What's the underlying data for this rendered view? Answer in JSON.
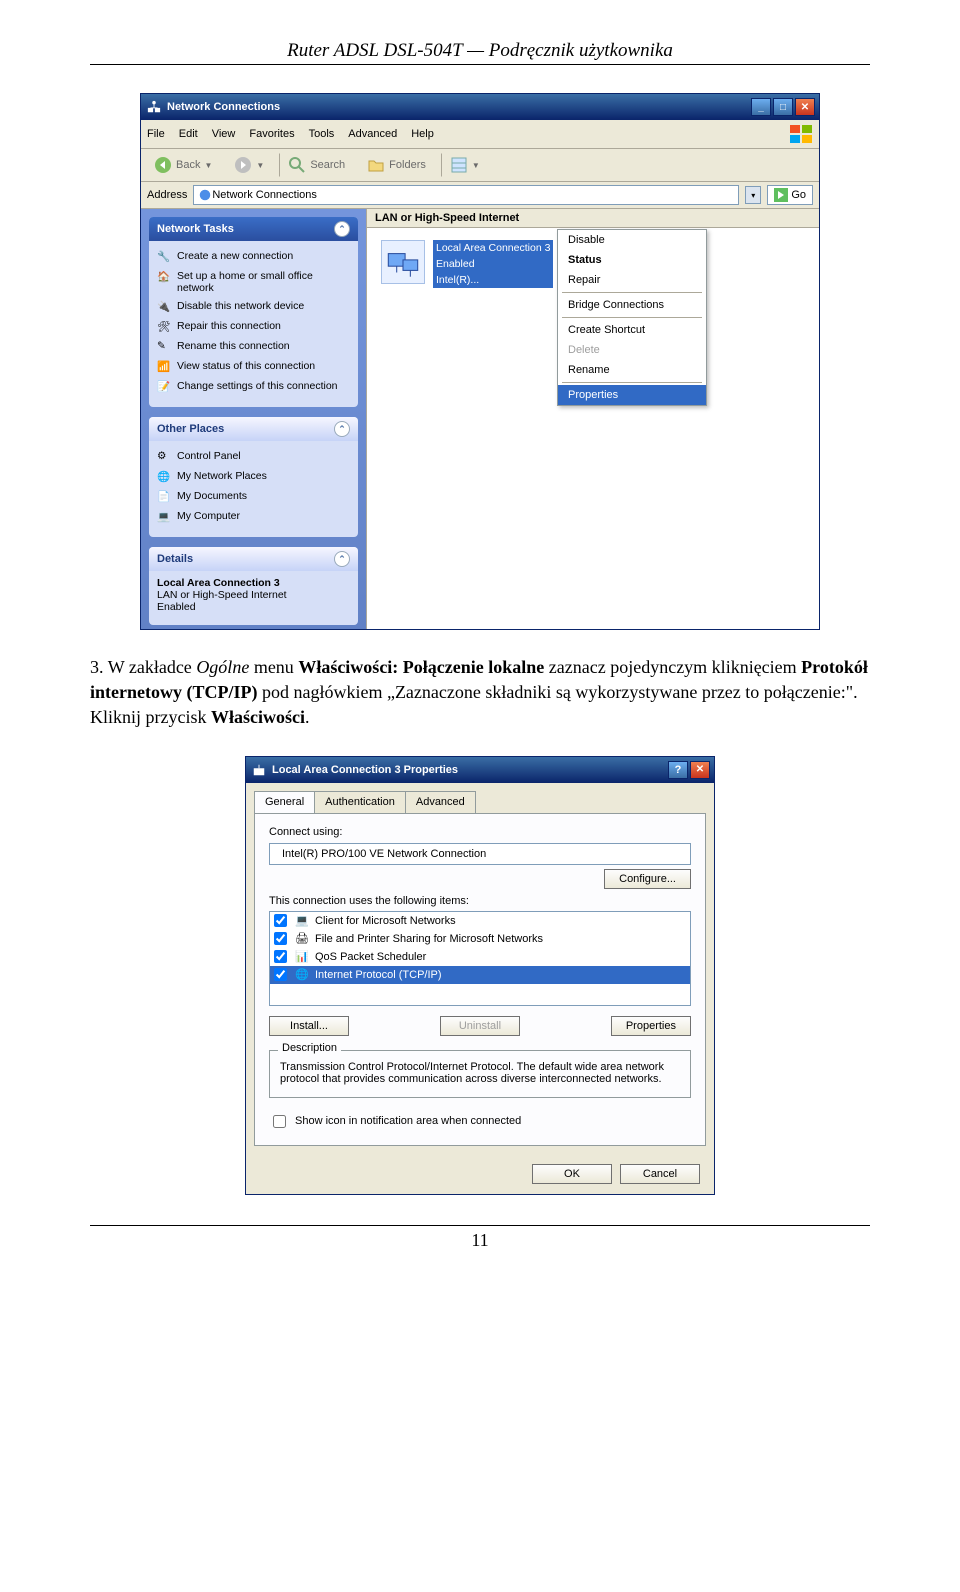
{
  "doc": {
    "header": "Ruter ADSL DSL-504T — Podręcznik użytkownika",
    "page_number": "11"
  },
  "instruction": {
    "num": "3.",
    "part1": "W zakładce ",
    "ogolne": "Ogólne",
    "part2": " menu ",
    "wlasc": "Właściwości: Połączenie lokalne",
    "part3": " zaznacz pojedynczym kliknięciem ",
    "proto": "Protokół internetowy (TCP/IP)",
    "part4": " pod nagłówkiem „Zaznaczone składniki są wykorzystywane przez to połączenie:\". Kliknij przycisk ",
    "btn": "Właściwości",
    "dot": "."
  },
  "win1": {
    "title": "Network Connections",
    "menus": [
      "File",
      "Edit",
      "View",
      "Favorites",
      "Tools",
      "Advanced",
      "Help"
    ],
    "toolbar": {
      "back": "Back",
      "search": "Search",
      "folders": "Folders"
    },
    "addr": {
      "label": "Address",
      "value": "Network Connections",
      "go": "Go"
    },
    "panels": {
      "tasks_title": "Network Tasks",
      "tasks": [
        "Create a new connection",
        "Set up a home or small office network",
        "Disable this network device",
        "Repair this connection",
        "Rename this connection",
        "View status of this connection",
        "Change settings of this connection"
      ],
      "places_title": "Other Places",
      "places": [
        "Control Panel",
        "My Network Places",
        "My Documents",
        "My Computer"
      ],
      "details_title": "Details",
      "details_name": "Local Area Connection 3",
      "details_sub": "LAN or High-Speed Internet",
      "details_state": "Enabled"
    },
    "main": {
      "category": "LAN or High-Speed Internet",
      "icon_lines": [
        "Local Area Connection 3",
        "Enabled",
        "Intel(R)..."
      ]
    },
    "ctx": {
      "disable": "Disable",
      "status": "Status",
      "repair": "Repair",
      "bridge": "Bridge Connections",
      "shortcut": "Create Shortcut",
      "delete": "Delete",
      "rename": "Rename",
      "properties": "Properties"
    }
  },
  "dlg": {
    "title": "Local Area Connection 3 Properties",
    "tabs": {
      "general": "General",
      "auth": "Authentication",
      "adv": "Advanced"
    },
    "connect_using_label": "Connect using:",
    "adapter": "Intel(R) PRO/100 VE Network Connection",
    "configure": "Configure...",
    "uses_label": "This connection uses the following items:",
    "items": [
      "Client for Microsoft Networks",
      "File and Printer Sharing for Microsoft Networks",
      "QoS Packet Scheduler",
      "Internet Protocol (TCP/IP)"
    ],
    "install": "Install...",
    "uninstall": "Uninstall",
    "properties": "Properties",
    "desc_title": "Description",
    "desc_text": "Transmission Control Protocol/Internet Protocol. The default wide area network protocol that provides communication across diverse interconnected networks.",
    "showicon": "Show icon in notification area when connected",
    "ok": "OK",
    "cancel": "Cancel"
  }
}
